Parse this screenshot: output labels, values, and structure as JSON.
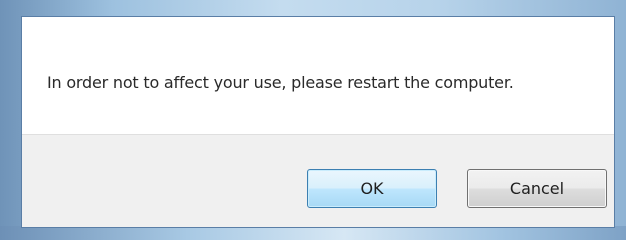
{
  "dialog": {
    "message": "In order not to affect your use, please restart the computer.",
    "buttons": {
      "ok_label": "OK",
      "cancel_label": "Cancel"
    },
    "colors": {
      "frame_accent": "#9dc1df",
      "ok_button_border": "#3c7fb1",
      "button_bar_background": "#f0f0f0"
    }
  }
}
